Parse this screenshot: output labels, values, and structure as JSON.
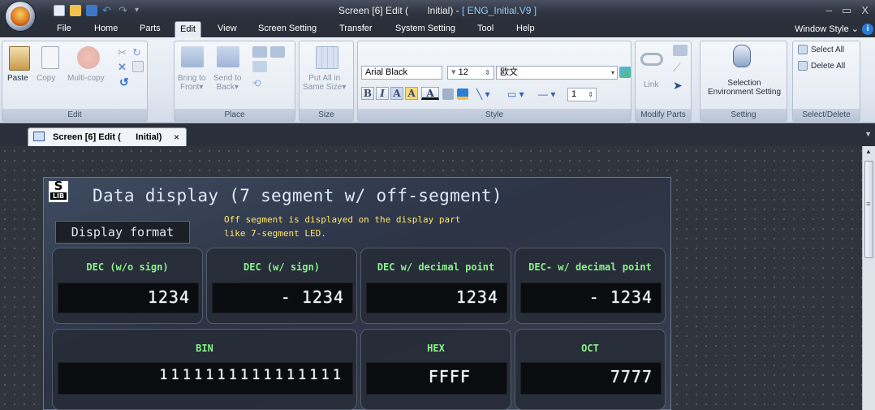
{
  "titlebar": {
    "title_prefix": "Screen [6] Edit (",
    "title_mid": "Initial) - ",
    "title_project": "[ ENG_Initial.V9 ]",
    "minimize": "–",
    "restore": "▭",
    "close": "X"
  },
  "menu": {
    "tabs": [
      "File",
      "Home",
      "Parts",
      "Edit",
      "View",
      "Screen Setting",
      "Transfer",
      "System Setting",
      "Tool",
      "Help"
    ],
    "active": "Edit",
    "window_style": "Window Style ⌄",
    "help_icon": "i"
  },
  "ribbon": {
    "edit": {
      "paste": "Paste",
      "copy": "Copy",
      "multi_copy": "Multi-copy",
      "label": "Edit"
    },
    "place": {
      "bring_to_front": "Bring to\nFront▾",
      "send_to_back": "Send to\nBack▾",
      "label": "Place"
    },
    "size": {
      "put_all": "Put All in\nSame Size▾",
      "label": "Size"
    },
    "style": {
      "font": "Arial Black",
      "size": "12",
      "charset": "欧文",
      "bold": "B",
      "italic": "I",
      "a1": "A",
      "a2": "A",
      "a3": "A",
      "line_width": "1",
      "label": "Style"
    },
    "modify": {
      "link": "Link",
      "label": "Modify Parts"
    },
    "setting": {
      "selection": "Selection\nEnvironment Setting",
      "label": "Setting"
    },
    "select_delete": {
      "select_all": "Select All",
      "delete_all": "Delete All",
      "label": "Select/Delete"
    }
  },
  "doc_tab": {
    "label": "Screen [6] Edit (      Initial)",
    "close": "×"
  },
  "screen": {
    "slib_s": "S",
    "slib_lib": "LIB",
    "title": "Data display (7 segment w/ off-segment)",
    "subtitle_line1": "Off segment is displayed on the display part",
    "subtitle_line2": "like 7-segment LED.",
    "display_format": "Display format",
    "cards": [
      {
        "title": "DEC (w/o sign)",
        "value": "1234"
      },
      {
        "title": "DEC (w/ sign)",
        "value": "- 1234"
      },
      {
        "title": "DEC w/ decimal point",
        "value": "1234"
      },
      {
        "title": "DEC- w/ decimal point",
        "value": "- 1234"
      },
      {
        "title": "BIN",
        "value": "1111111111111111"
      },
      {
        "title": "HEX",
        "value": "FFFF"
      },
      {
        "title": "OCT",
        "value": "7777"
      }
    ]
  }
}
